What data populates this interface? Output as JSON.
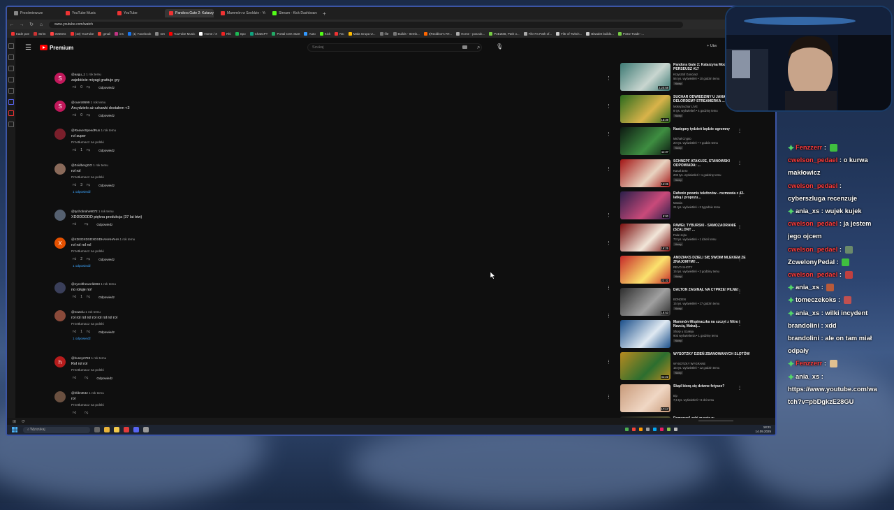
{
  "browser": {
    "tabs": [
      {
        "label": "Prześmiewcze",
        "active": false
      },
      {
        "label": "YouTube Music",
        "active": false
      },
      {
        "label": "YouTube",
        "active": false
      },
      {
        "label": "Pandora Gate 2: Katarzyna",
        "active": true
      },
      {
        "label": "Mammón w Szoldzie - Yo",
        "active": false
      },
      {
        "label": "Stream - Kick Dashboard",
        "active": false
      }
    ],
    "url": "www.youtube.com/watch",
    "bookmarks": [
      "trade poe",
      "Strim",
      "eMeteG",
      "(10) YouTube",
      "gmail",
      "ins",
      "(1) Facebook",
      "net",
      "YouTube Music",
      "Home / X",
      "Rki",
      "Spo",
      "ChatGPT",
      "Portal CSK Start",
      "Auto",
      "Kick",
      "NC",
      "Mała Grupa U...",
      "filtr",
      "Builds - Itemb...",
      "I(Redditor's RT...",
      "Home - poszuk...",
      "PoE2DB, Path o...",
      "Filtr Pa Path of...",
      "Filtr of Twitch...",
      "Bitwalet builds...",
      "PoE2 Trade -..."
    ]
  },
  "youtube": {
    "brand": "Premium",
    "search_placeholder": "Szukaj",
    "header_right": "Utw"
  },
  "comments": [
    {
      "user": "@aagu_1",
      "time": "1 rok temu",
      "text": "zajebiście miyagi grattuje gry",
      "translate": "",
      "likes": "0",
      "reply": "Odpowiedz",
      "replies": "",
      "avatar": "S",
      "color": "#c2185b"
    },
    {
      "user": "@cuero9599",
      "time": "1 rok temu",
      "text": "Arcydzieło aż czkawki dostałem <3",
      "translate": "",
      "likes": "0",
      "reply": "Odpowiedz",
      "replies": "",
      "avatar": "S",
      "color": "#c2185b"
    },
    {
      "user": "@ReaverSpeedRun",
      "time": "1 rok temu",
      "text": "rol super",
      "translate": "Przetłumacz na polski",
      "likes": "1",
      "reply": "Odpowiedz",
      "replies": "",
      "avatar": "",
      "color": "#7a1f2b"
    },
    {
      "user": "@ZoidbergGO",
      "time": "1 rok temu",
      "text": "rol rol",
      "translate": "Przetłumacz na polski",
      "likes": "3",
      "reply": "Odpowiedz",
      "replies": "1 odpowiedź",
      "avatar": "",
      "color": "#8a6a5a"
    },
    {
      "user": "@tychobrahe9072",
      "time": "1 rok temu",
      "text": "XDDDDDDD piękna produkcja (37 lat btw)",
      "translate": "",
      "likes": "",
      "reply": "Odpowiedz",
      "replies": "",
      "avatar": "",
      "color": "#556070"
    },
    {
      "user": "@XDXDXDXDXDXDHAHAHAHA",
      "time": "1 rok temu",
      "text": "rol rol rol rol",
      "translate": "Przetłumacz na polski",
      "likes": "2",
      "reply": "Odpowiedz",
      "replies": "1 odpowiedź",
      "avatar": "X",
      "color": "#e65100"
    },
    {
      "user": "@eyeoftheworld693",
      "time": "1 rok temu",
      "text": "no rołuje no!",
      "translate": "",
      "likes": "1",
      "reply": "Odpowiedz",
      "replies": "",
      "avatar": "",
      "color": "#3a3f5a"
    },
    {
      "user": "@nowclu",
      "time": "1 rok temu",
      "text": "rol rol rol rol rol rol rol rol rol",
      "translate": "Przetłumacz na polski",
      "likes": "1",
      "reply": "Odpowiedz",
      "replies": "1 odpowiedź",
      "avatar": "",
      "color": "#8a4a3a"
    },
    {
      "user": "@husey2783",
      "time": "1 rok temu",
      "text": "Rol rol rol",
      "translate": "Przetłumacz na polski",
      "likes": "",
      "reply": "Odpowiedz",
      "replies": "",
      "avatar": "h",
      "color": "#b71c1c"
    },
    {
      "user": "@hfdm9t42",
      "time": "1 rok temu",
      "text": "rol",
      "translate": "Przetłumacz na polski",
      "likes": "",
      "reply": "",
      "replies": "",
      "avatar": "",
      "color": "#6a5040"
    }
  ],
  "recommendations": [
    {
      "title": "Pandora Gate 2: Katarzyna Mocinski. PERSEUSZ #17",
      "channel": "Krzysztof Gonciarz",
      "stats": "56 tys. wyświetleń • 10 godzin temu",
      "badge": "Nowy",
      "duration": "2:20:58",
      "c1": "#3d7a74",
      "c2": "#c9d6d0"
    },
    {
      "title": "SUCHAR ODWIEDZINY U JANA Z DELORDEM? STREAMERKA ...",
      "channel": "MokrySuchar LIVE",
      "stats": "8 tys. wyświetleń • 4 godziny temu",
      "badge": "Nowy",
      "duration": "15:39",
      "c1": "#2a6b1d",
      "c2": "#d9b34a"
    },
    {
      "title": "Następny tydzień będzie ogromny",
      "channel": "Michał Crypto",
      "stats": "20 tys. wyświetleń • 7 godzin temu",
      "badge": "Nowy",
      "duration": "11:37",
      "c1": "#0d1a12",
      "c2": "#3e8e41"
    },
    {
      "title": "SCHNEPF ATAKUJE, STANOWSKI ODPOWIADA: ...",
      "channel": "Kanał Zero",
      "stats": "203 tys. wyświetleń • 1 godzinę temu",
      "badge": "Nowy",
      "duration": "14:26",
      "c1": "#a31515",
      "c2": "#e8d3c0"
    },
    {
      "title": "Rafonix pownis telefonów - rozmowia z 42-latką i propozu...",
      "channel": "Manda",
      "stats": "21 tys. wyświetleń • 3 tygodnie temu",
      "badge": "",
      "duration": "6:00",
      "c1": "#2b1f4a",
      "c2": "#c94a7a"
    },
    {
      "title": "PAWEŁ TYBURSKI - SAMOZAORANIE (SZALONY ...",
      "channel": "Fala Hejtu",
      "stats": "73 tys. wyświetleń • 1 dzień temu",
      "badge": "Nowy",
      "duration": "16:25",
      "c1": "#7a0d0d",
      "c2": "#f2e6d9"
    },
    {
      "title": "ANDZIAKS DZIELI SIĘ SWOIM MLEKIEM ZE ZNAJOMYMI! ...",
      "channel": "REVO SHOTY",
      "stats": "15 tys. wyświetleń • 3 godziny temu",
      "badge": "Nowy",
      "duration": "23:32",
      "c1": "#c62828",
      "c2": "#fbe26d"
    },
    {
      "title": "DALTON ZAGINĄŁ NA CYPRZE! PILNE!",
      "channel": "BONDEN",
      "stats": "15 tys. wyświetleń • 17 godzin temu",
      "badge": "Nowy",
      "duration": "18:53",
      "c1": "#2e2e2e",
      "c2": "#a0a0a0"
    },
    {
      "title": "Mammón-Wspinaczka na szczyt z Nitro i Navcią, Makaij...",
      "channel": "Shoty u Szaleja",
      "stats": "903 wyświetlenia • 1 godzinę temu",
      "badge": "Nowy",
      "duration": "",
      "c1": "#1b4f8a",
      "c2": "#dfe9f2"
    },
    {
      "title": "WYSOTZKY DZIEŃ ZBANOWANYCH SLOTÓW",
      "channel": "WYSOTZKY WYGRANE",
      "stats": "15 tys. wyświetleń • 12 godzin temu",
      "badge": "Nowy",
      "duration": "41:22",
      "c1": "#b88a1f",
      "c2": "#2c6e2f"
    },
    {
      "title": "Skąd biorą się dziwne fetysze?",
      "channel": "trip",
      "stats": "7,5 tys. wyświetleń • 8 dni temu",
      "badge": "",
      "duration": "17:17",
      "c1": "#c89a7a",
      "c2": "#f0d7c4"
    },
    {
      "title": "Demonzz1 robi questa w",
      "channel": "",
      "stats": "",
      "badge": "",
      "duration": "",
      "c1": "#1a1a1a",
      "c2": "#553"
    }
  ],
  "taskbar": {
    "search": "Wyszukaj",
    "time": "18:21",
    "date": "14.09.2025"
  },
  "chat": {
    "lines": [
      {
        "user": "Fenzzerr",
        "sep": " : ",
        "msg": "",
        "color": "#ff3b3b",
        "badge": true,
        "emote": "#3fbf3f"
      },
      {
        "user": "cwelson_pedael",
        "sep": " : ",
        "msg": "o kurwa",
        "color": "#ff3b3b",
        "badge": false,
        "emote": ""
      },
      {
        "user": "",
        "sep": "",
        "msg": "makłowicz",
        "color": "",
        "badge": false,
        "emote": ""
      },
      {
        "user": "cwelson_pedael",
        "sep": " : ",
        "msg": "",
        "color": "#ff3b3b",
        "badge": false,
        "emote": ""
      },
      {
        "user": "",
        "sep": "",
        "msg": "cyberszluga recenzuje",
        "color": "",
        "badge": false,
        "emote": ""
      },
      {
        "user": "ania_xs",
        "sep": " : ",
        "msg": "wujek kujek",
        "color": "#ffffff",
        "badge": true,
        "emote": ""
      },
      {
        "user": "cwelson_pedael",
        "sep": " : ",
        "msg": "ja jestem",
        "color": "#ff3b3b",
        "badge": false,
        "emote": ""
      },
      {
        "user": "",
        "sep": "",
        "msg": "jego ojcem",
        "color": "",
        "badge": false,
        "emote": ""
      },
      {
        "user": "cwelson_pedael",
        "sep": " : ",
        "msg": "",
        "color": "#ff3b3b",
        "badge": false,
        "emote": "#6a8a6a"
      },
      {
        "user": "ZcwelonyPedal",
        "sep": " : ",
        "msg": "",
        "color": "#ffffff",
        "badge": false,
        "emote": "#3fbf3f"
      },
      {
        "user": "cwelson_pedael",
        "sep": " : ",
        "msg": "",
        "color": "#ff3b3b",
        "badge": false,
        "emote": "#c04040"
      },
      {
        "user": "ania_xs",
        "sep": " : ",
        "msg": "",
        "color": "#ffffff",
        "badge": true,
        "emote": "#b85a3a"
      },
      {
        "user": "tomeczekoks",
        "sep": " : ",
        "msg": "",
        "color": "#ffffff",
        "badge": true,
        "emote": "#c05050"
      },
      {
        "user": "ania_xs",
        "sep": " : ",
        "msg": "wilki incydent",
        "color": "#ffffff",
        "badge": true,
        "emote": ""
      },
      {
        "user": "brandolini",
        "sep": " : ",
        "msg": "xdd",
        "color": "#ffffff",
        "badge": false,
        "emote": ""
      },
      {
        "user": "brandolini",
        "sep": " : ",
        "msg": "ale on tam miał",
        "color": "#ffffff",
        "badge": false,
        "emote": ""
      },
      {
        "user": "",
        "sep": "",
        "msg": "odpały",
        "color": "",
        "badge": false,
        "emote": ""
      },
      {
        "user": "Fenzzerr",
        "sep": " : ",
        "msg": "",
        "color": "#ff3b3b",
        "badge": true,
        "emote": "#e0c090"
      },
      {
        "user": "ania_xs",
        "sep": " : ",
        "msg": "",
        "color": "#ffffff",
        "badge": true,
        "emote": ""
      },
      {
        "user": "",
        "sep": "",
        "msg": "https://www.youtube.com/wa",
        "color": "",
        "badge": false,
        "emote": ""
      },
      {
        "user": "",
        "sep": "",
        "msg": "tch?v=pbDgkzE28GU",
        "color": "",
        "badge": false,
        "emote": ""
      }
    ]
  },
  "colors": {
    "accent": "#3ea6ff",
    "yt_red": "#ff0000",
    "frame_border": "#3c55a5"
  }
}
